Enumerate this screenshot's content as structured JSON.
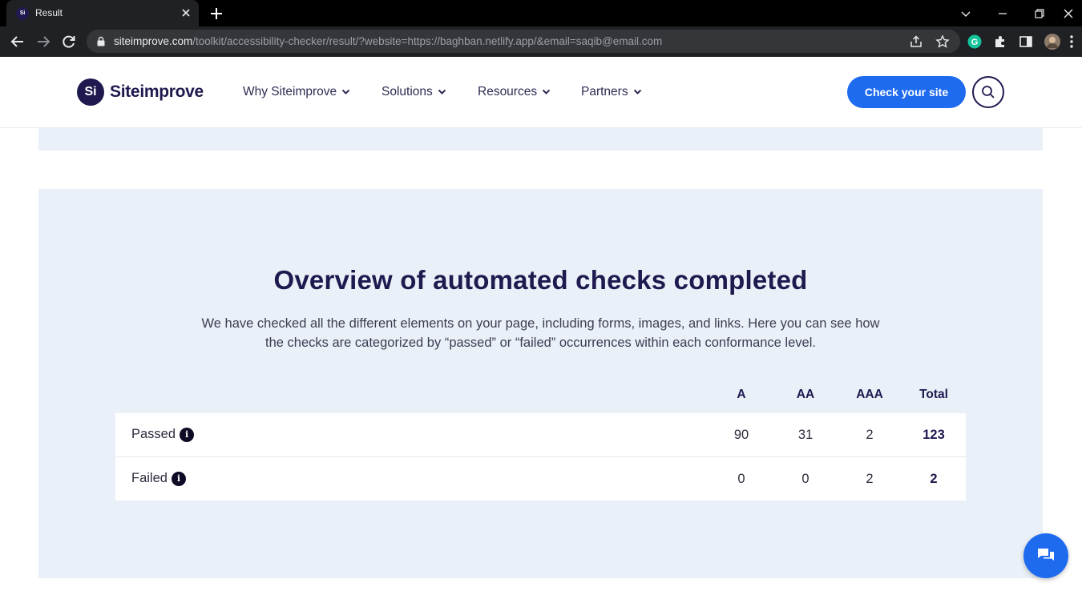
{
  "browser": {
    "tab_title": "Result",
    "tab_favicon_text": "Si",
    "url_host": "siteimprove.com",
    "url_path": "/toolkit/accessibility-checker/result/?website=https://baghban.netlify.app/&email=saqib@email.com"
  },
  "header": {
    "logo_mark": "Si",
    "logo_text": "Siteimprove",
    "nav": [
      "Why Siteimprove",
      "Solutions",
      "Resources",
      "Partners"
    ],
    "cta_label": "Check your site"
  },
  "overview": {
    "title": "Overview of automated checks completed",
    "description": "We have checked all the different elements on your page, including forms, images, and links. Here you can see how the checks are categorized by “passed” or “failed” occurrences within each conformance level.",
    "columns": [
      "A",
      "AA",
      "AAA",
      "Total"
    ],
    "rows": [
      {
        "label": "Passed",
        "values": [
          "90",
          "31",
          "2",
          "123"
        ]
      },
      {
        "label": "Failed",
        "values": [
          "0",
          "0",
          "2",
          "2"
        ]
      }
    ]
  },
  "colors": {
    "brand": "#1e1a4f",
    "accent": "#1f6bf0",
    "panel_bg": "#eaf0f7"
  },
  "icons": [
    "search-icon",
    "chevron-down-icon",
    "info-icon",
    "chat-icon"
  ]
}
